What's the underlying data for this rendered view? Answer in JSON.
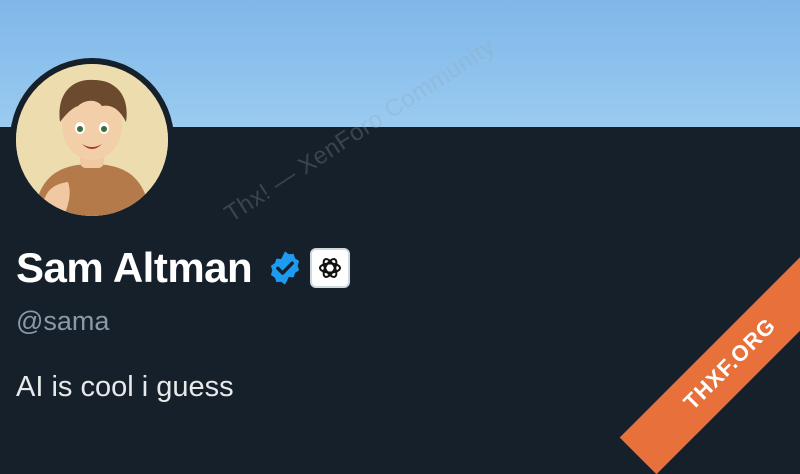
{
  "profile": {
    "display_name": "Sam Altman",
    "handle": "@sama",
    "bio": "AI is cool i guess",
    "verified_icon": "verified-badge-icon",
    "org_icon": "openai-logo-icon"
  },
  "overlay": {
    "watermark": "Thx! — XenForo Community",
    "corner_ribbon": "THXF.ORG"
  },
  "colors": {
    "banner": "#8fc3ee",
    "background": "#15202b",
    "verified": "#1d9bf0",
    "ribbon": "#e8703a"
  }
}
